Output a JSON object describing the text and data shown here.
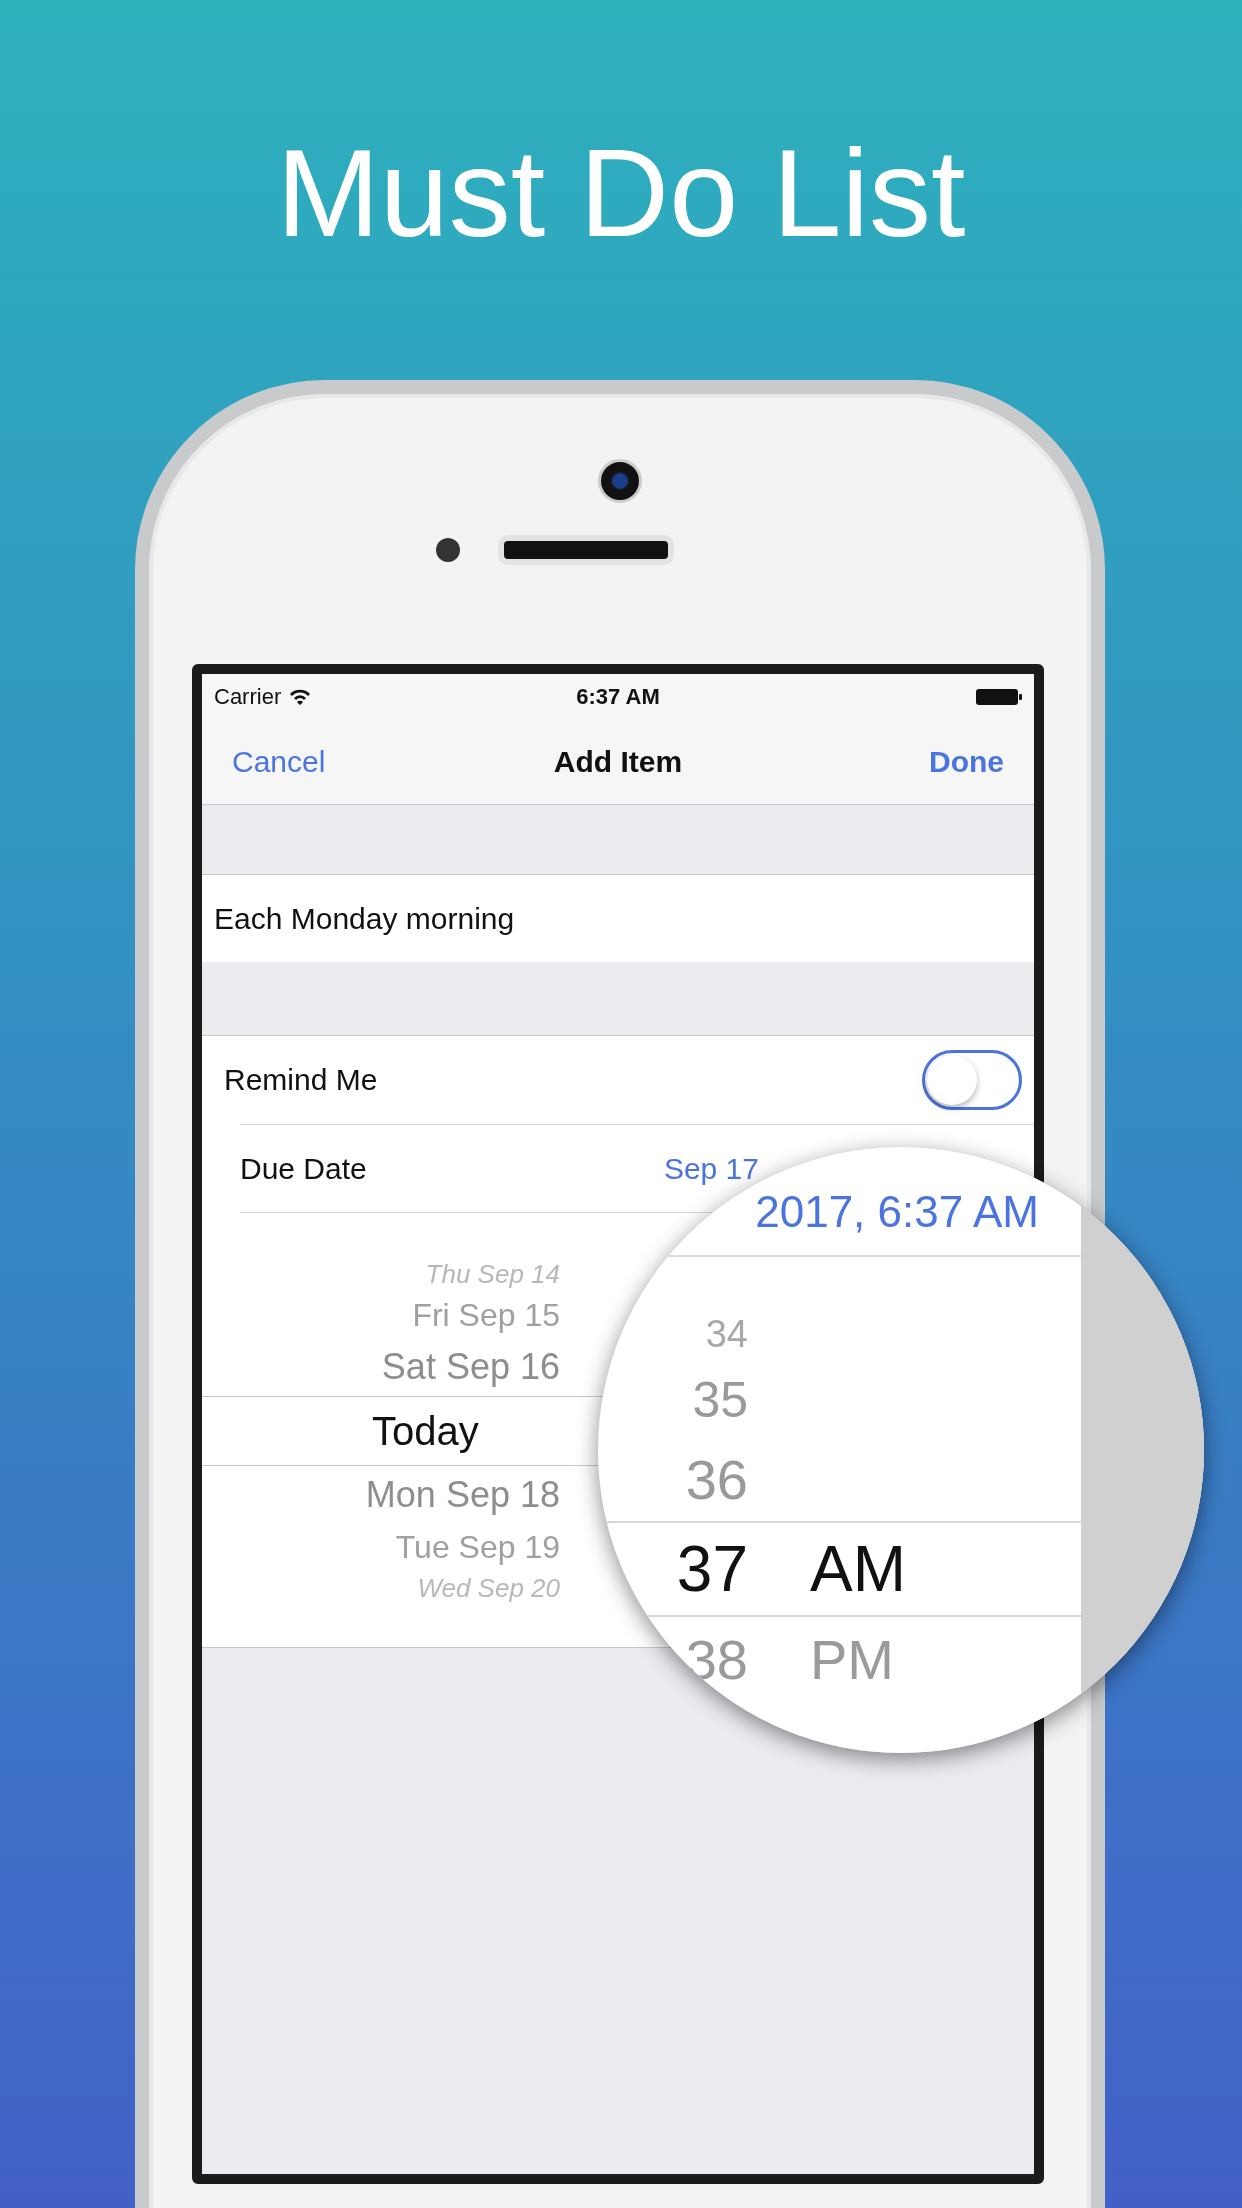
{
  "title": "Must Do List",
  "status_bar": {
    "carrier": "Carrier",
    "time": "6:37 AM"
  },
  "nav": {
    "left": "Cancel",
    "title": "Add Item",
    "right": "Done"
  },
  "item_text": "Each Monday morning",
  "remind": {
    "label": "Remind Me",
    "on": false
  },
  "due": {
    "label": "Due Date",
    "value": "Sep 17"
  },
  "picker": {
    "days": [
      {
        "label": "Thu Sep 14",
        "selected": false
      },
      {
        "label": "Fri Sep 15",
        "selected": false
      },
      {
        "label": "Sat Sep 16",
        "selected": false
      },
      {
        "label": "Today",
        "selected": true
      },
      {
        "label": "Mon Sep 18",
        "selected": false
      },
      {
        "label": "Tue Sep 19",
        "selected": false
      },
      {
        "label": "Wed Sep 20",
        "selected": false
      }
    ]
  },
  "magnifier": {
    "value": "2017, 6:37 AM",
    "minutes": [
      {
        "label": "34",
        "selected": false
      },
      {
        "label": "35",
        "selected": false
      },
      {
        "label": "36",
        "selected": false
      },
      {
        "label": "37",
        "selected": true
      },
      {
        "label": "38",
        "selected": false
      }
    ],
    "periods": [
      {
        "label": "AM",
        "selected": true
      },
      {
        "label": "PM",
        "selected": false
      }
    ]
  }
}
